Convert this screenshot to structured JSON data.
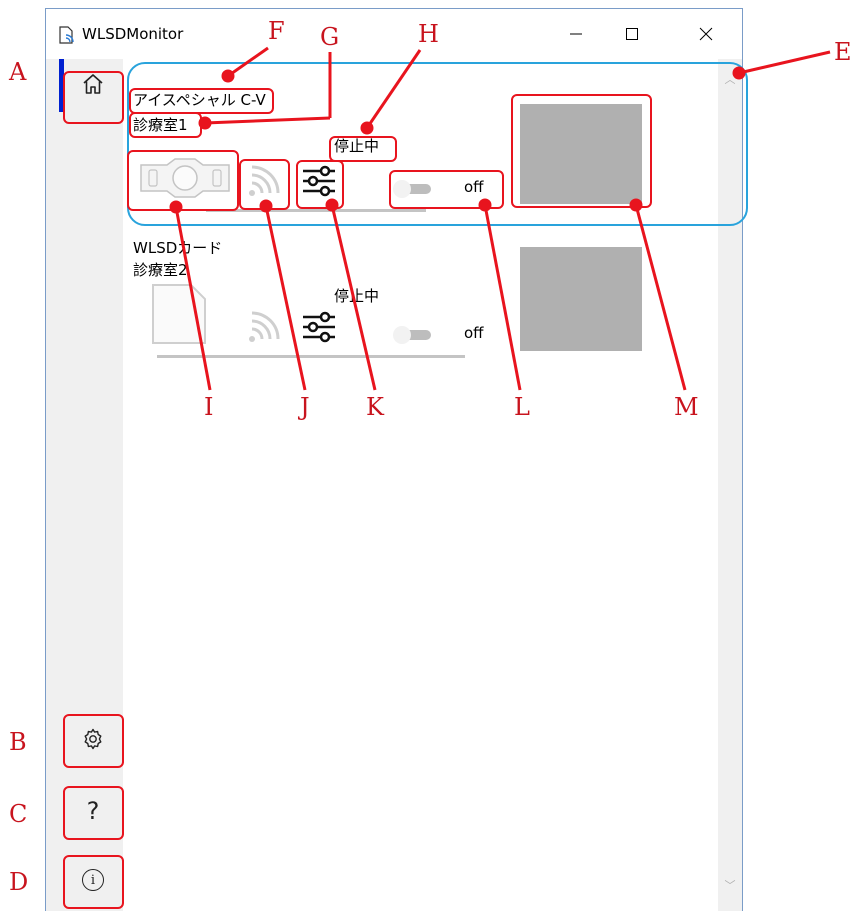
{
  "window": {
    "title": "WLSDMonitor",
    "controls": [
      "minimize",
      "maximize",
      "close"
    ]
  },
  "nav": {
    "items": [
      {
        "name": "home",
        "icon": "home-icon"
      },
      {
        "name": "settings",
        "icon": "gear-icon"
      },
      {
        "name": "help",
        "icon": "question-icon",
        "glyph": "?"
      },
      {
        "name": "info",
        "icon": "info-icon",
        "glyph": "i"
      }
    ]
  },
  "devices": [
    {
      "name": "アイスペシャル C-V",
      "room": "診療室1",
      "status": "停止中",
      "toggle_label": "off",
      "icon": "intraoral-sensor-icon"
    },
    {
      "name": "WLSDカード",
      "room": "診療室2",
      "status": "停止中",
      "toggle_label": "off",
      "icon": "sd-card-icon"
    }
  ],
  "annotations": {
    "A": "A",
    "B": "B",
    "C": "C",
    "D": "D",
    "E": "E",
    "F": "F",
    "G": "G",
    "H": "H",
    "I": "I",
    "J": "J",
    "K": "K",
    "L": "L",
    "M": "M"
  },
  "colors": {
    "nav_indicator": "#0020d0",
    "annotation_red": "#e8141e",
    "annotation_blue": "#29a3dc",
    "thumbnail_gray": "#b0b0b0"
  }
}
